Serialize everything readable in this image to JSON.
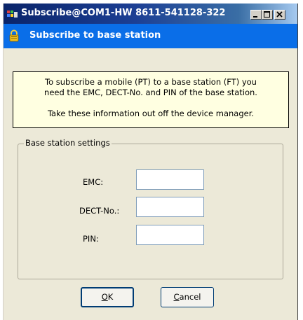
{
  "window": {
    "title": "Subscribe@COM1-HW 8611-541128-322",
    "icon": "app-icon",
    "controls": {
      "minimize": "minimize-icon",
      "maximize": "maximize-icon",
      "close": "close-icon"
    }
  },
  "header": {
    "icon": "lock-icon",
    "title": "Subscribe to base station"
  },
  "info": {
    "line1": "To subscribe a mobile (PT) to a base station (FT) you",
    "line2": "need the EMC, DECT-No. and PIN of the base station.",
    "line3": "Take these information out off the device manager."
  },
  "group": {
    "label": "Base station settings",
    "fields": [
      {
        "label": "EMC:",
        "value": ""
      },
      {
        "label": "DECT-No.:",
        "value": ""
      },
      {
        "label": "PIN:",
        "value": ""
      }
    ]
  },
  "buttons": {
    "ok": {
      "mnemonic": "O",
      "rest": "K"
    },
    "cancel": {
      "mnemonic": "C",
      "rest": "ancel"
    }
  },
  "colors": {
    "header": "#0a6ee8",
    "dialog_bg": "#ece9d8",
    "info_bg": "#ffffe1",
    "titlebar_start": "#0a246a",
    "titlebar_end": "#a6caf0"
  }
}
